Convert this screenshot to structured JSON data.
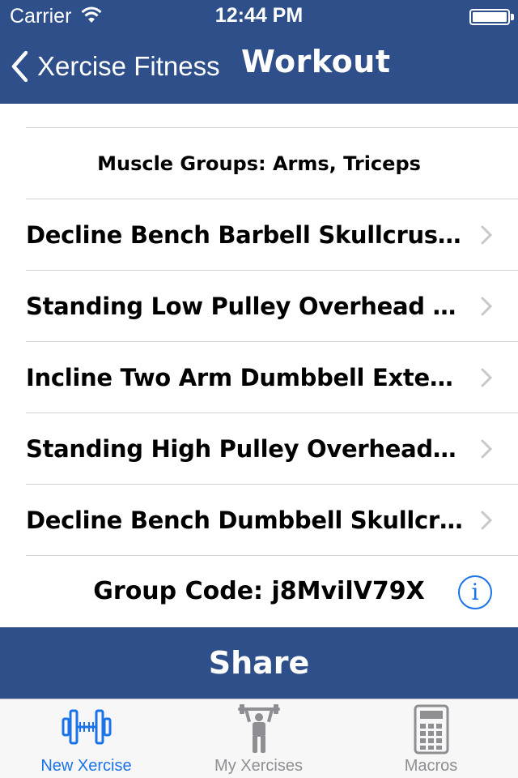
{
  "status_bar": {
    "carrier": "Carrier",
    "time": "12:44 PM"
  },
  "nav": {
    "back_label": "Xercise Fitness",
    "title": "Workout"
  },
  "list": {
    "muscle_groups": "Muscle Groups: Arms, Triceps",
    "exercises": [
      {
        "label": "Decline Bench Barbell Skullcrushers"
      },
      {
        "label": "Standing Low Pulley Overhead Tric..."
      },
      {
        "label": "Incline Two Arm Dumbbell Extension"
      },
      {
        "label": "Standing High Pulley Overhead Tric..."
      },
      {
        "label": "Decline Bench Dumbbell Skullcrushe..."
      }
    ],
    "group_code": "Group Code: j8MvilV79X"
  },
  "share_label": "Share",
  "tabs": [
    {
      "label": "New Xercise",
      "icon": "dumbbell-icon",
      "active": true
    },
    {
      "label": "My Xercises",
      "icon": "weightlifter-icon",
      "active": false
    },
    {
      "label": "Macros",
      "icon": "calculator-icon",
      "active": false
    }
  ],
  "colors": {
    "brand": "#2f4f8a",
    "accent": "#1a73e8",
    "inactive": "#8e8e93"
  }
}
